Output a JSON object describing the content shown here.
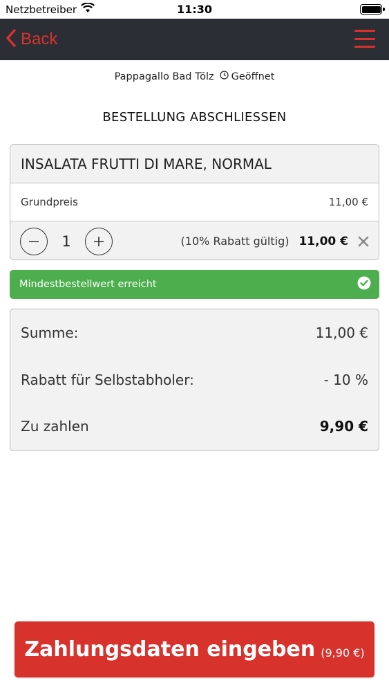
{
  "status_bar": {
    "carrier": "Netzbetreiber",
    "time": "11:30",
    "wifi_icon": "wifi-icon",
    "battery_level": 1.0
  },
  "nav": {
    "back_label": "Back",
    "back_icon": "chevron-left-icon",
    "menu_icon": "hamburger-menu-icon",
    "accent_color": "#d8322c",
    "bar_color": "#2b2f35"
  },
  "shop": {
    "name": "Pappagallo Bad Tölz",
    "status_icon": "clock-icon",
    "status": "Geöffnet"
  },
  "page": {
    "title": "BESTELLUNG ABSCHLIESSEN"
  },
  "cart": {
    "item": {
      "name": "INSALATA FRUTTI DI MARE, NORMAL",
      "base_price_label": "Grundpreis",
      "base_price": "11,00 €",
      "quantity": "1",
      "discount_note": "(10% Rabatt gültig)",
      "total": "11,00 €"
    }
  },
  "banner": {
    "text": "Mindestbestellwert erreicht",
    "icon": "check-circle-icon",
    "color": "#4cae4c"
  },
  "summary": {
    "sum_label": "Summe:",
    "sum_value": "11,00 €",
    "discount_label": "Rabatt für Selbstabholer:",
    "discount_value": "- 10 %",
    "pay_label": "Zu zahlen",
    "pay_value": "9,90 €"
  },
  "pay_button": {
    "label": "Zahlungsdaten eingeben",
    "amount": "(9,90 €)"
  }
}
